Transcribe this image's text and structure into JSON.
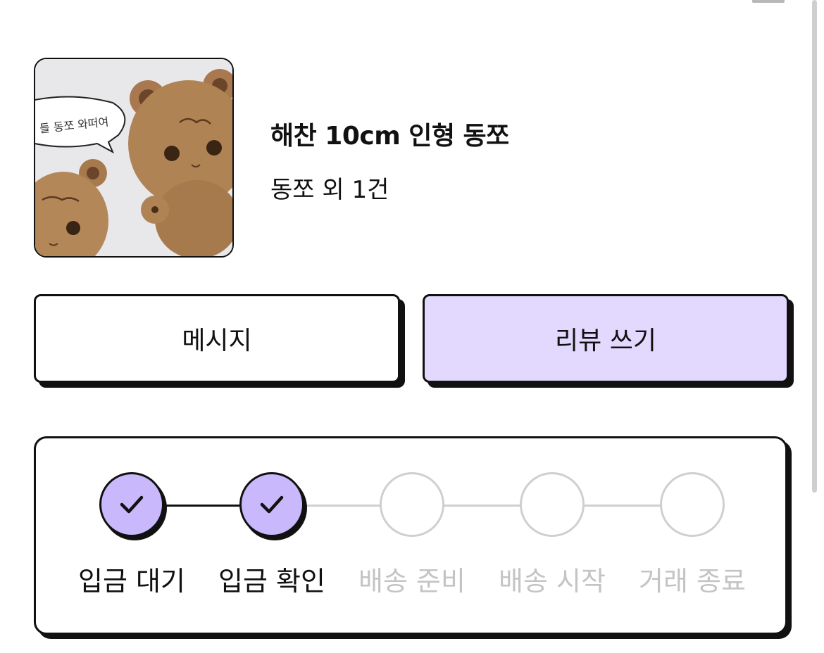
{
  "product": {
    "image_caption": "들 동쪼 와떠여",
    "title": "해찬 10cm 인형 동쪼",
    "subtitle": "동쪼 외 1건"
  },
  "actions": {
    "message_label": "메시지",
    "review_label": "리뷰 쓰기"
  },
  "progress": {
    "steps": [
      {
        "label": "입금 대기",
        "status": "done",
        "icon": "check-icon"
      },
      {
        "label": "입금 확인",
        "status": "done",
        "icon": "check-icon"
      },
      {
        "label": "배송 준비",
        "status": "todo"
      },
      {
        "label": "배송 시작",
        "status": "todo"
      },
      {
        "label": "거래 종료",
        "status": "todo"
      }
    ]
  },
  "colors": {
    "accent": "#c9b8fb",
    "review_button_bg": "#e3d9ff",
    "inactive": "#c4c4c4",
    "outline": "#111111"
  }
}
